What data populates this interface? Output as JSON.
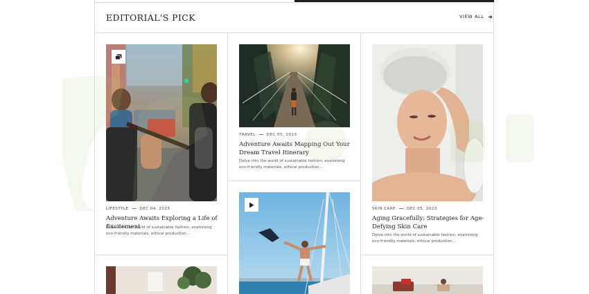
{
  "header": {
    "section_title": "EDITORIAL'S PICK",
    "view_all_label": "VIEW ALL"
  },
  "icons": {
    "view_all_arrow": "arrow-right-icon",
    "gallery_badge": "gallery-icon",
    "video_badge": "play-icon"
  },
  "posts": [
    {
      "category": "LIFESTYLE",
      "date": "DEC 04, 2023",
      "title": "Adventure Awaits Exploring a Life of Excitement",
      "excerpt": "Delve into the world of sustainable fashion, examining eco-friendly materials, ethical production..."
    },
    {
      "category": "TRAVEL",
      "date": "DEC 05, 2023",
      "title": "Adventure Awaits Mapping Out Your Dream Travel Itinerary",
      "excerpt": "Delve into the world of sustainable fashion, examining eco-friendly materials, ethical production..."
    },
    {
      "category": "SKIN CARE",
      "date": "DEC 05, 2023",
      "title": "Aging Gracefully: Strategies for Age-Defying Skin Care",
      "excerpt": "Delve into the world of sustainable fashion, examining eco-friendly materials, ethical production..."
    }
  ],
  "colors": {
    "border": "#d9d9d9",
    "text": "#222222",
    "muted": "#555555",
    "watermark": "#b8cf86"
  }
}
